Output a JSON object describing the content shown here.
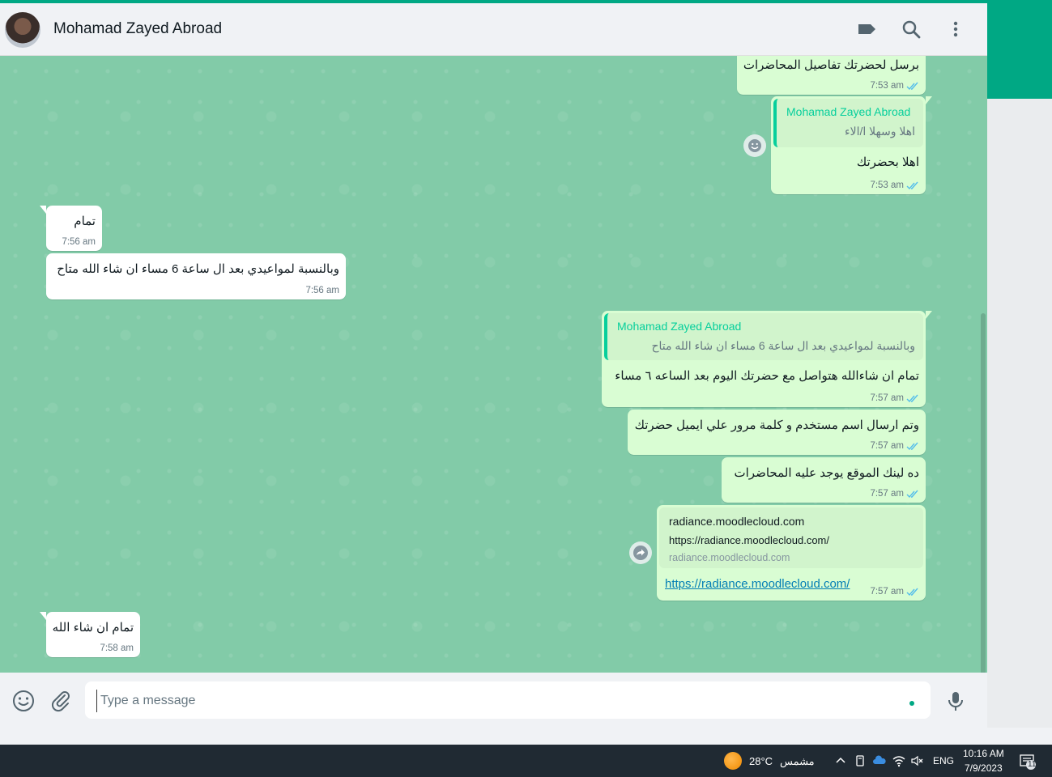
{
  "header": {
    "contact_name": "Mohamad Zayed Abroad",
    "icons": [
      "label-icon",
      "search-icon",
      "menu-icon"
    ]
  },
  "messages": [
    {
      "id": "m1",
      "dir": "out",
      "text": "برسل لحضرتك تفاصيل المحاضرات",
      "time": "7:53 am",
      "status": "read"
    },
    {
      "id": "m2",
      "dir": "out",
      "quote_author": "Mohamad Zayed Abroad",
      "quote_text": "اهلا وسهلا ا/الاء",
      "text": "اهلا بحضرتك",
      "time": "7:53 am",
      "status": "read"
    },
    {
      "id": "m3",
      "dir": "in",
      "text": "تمام",
      "time": "7:56 am"
    },
    {
      "id": "m4",
      "dir": "in",
      "text": "وبالنسبة لمواعيدي بعد ال ساعة 6 مساء ان شاء الله متاح",
      "time": "7:56 am"
    },
    {
      "id": "m5",
      "dir": "out",
      "quote_author": "Mohamad Zayed Abroad",
      "quote_text": "وبالنسبة لمواعيدي بعد ال ساعة 6 مساء ان شاء الله متاح",
      "text": "تمام ان شاءالله هتواصل مع حضرتك اليوم بعد الساعه ٦ مساء",
      "time": "7:57 am",
      "status": "read"
    },
    {
      "id": "m6",
      "dir": "out",
      "text": "وتم ارسال اسم مستخدم و كلمة مرور علي ايميل حضرتك",
      "time": "7:57 am",
      "status": "read"
    },
    {
      "id": "m7",
      "dir": "out",
      "text": "ده لينك الموقع يوجد عليه المحاضرات",
      "time": "7:57 am",
      "status": "read"
    },
    {
      "id": "m8",
      "dir": "out",
      "preview_title": "radiance.moodlecloud.com",
      "preview_desc": "https://radiance.moodlecloud.com/",
      "preview_domain": "radiance.moodlecloud.com",
      "link": "https://radiance.moodlecloud.com/",
      "time": "7:57 am",
      "status": "read"
    },
    {
      "id": "m9",
      "dir": "in",
      "text": "تمام ان شاء الله",
      "time": "7:58 am"
    }
  ],
  "composer": {
    "placeholder": "Type a message",
    "icons": [
      "emoji-icon",
      "attach-icon",
      "mic-icon"
    ]
  },
  "taskbar": {
    "weather_temp": "28°C",
    "weather_label": "مشمس",
    "language": "ENG",
    "time": "10:16 AM",
    "date": "7/9/2023",
    "notifications_count": "11"
  },
  "colors": {
    "accent": "#00a884",
    "chat_bg": "#82cba8",
    "outgoing_bubble": "#d9fdd3",
    "incoming_bubble": "#ffffff",
    "read_tick": "#53bdeb",
    "quote_author": "#06cf9c",
    "link": "#027eb5"
  }
}
